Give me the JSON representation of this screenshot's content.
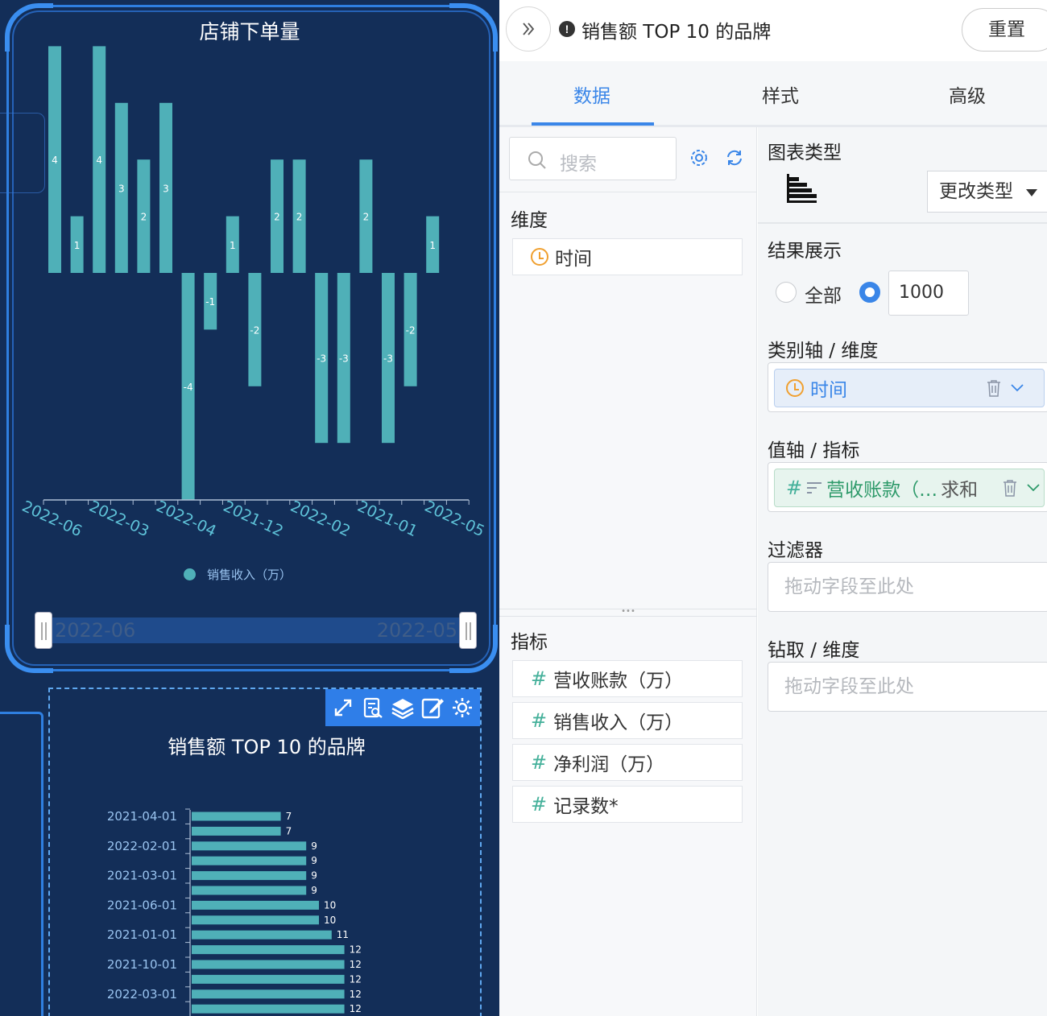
{
  "dashboard": {
    "card1": {
      "title": "店铺下单量",
      "legend": "销售收入（万）",
      "zoom_start": "2022-06",
      "zoom_end": "2022-05"
    },
    "card2": {
      "title": "销售额 TOP 10 的品牌",
      "toolbar_icons": [
        "expand-icon",
        "data-view-icon",
        "layers-icon",
        "edit-icon",
        "gear-icon"
      ]
    }
  },
  "chart_data": [
    {
      "type": "bar",
      "title": "店铺下单量",
      "categories": [
        "2022-06",
        "",
        "2022-03",
        "",
        "2022-04",
        "",
        "2021-12",
        "",
        "2022-02",
        "",
        "2021-01",
        "",
        "2022-05"
      ],
      "series": [
        {
          "name": "销售收入（万）",
          "values": [
            4,
            1,
            4,
            3,
            2,
            3,
            -4,
            -1,
            1,
            -2,
            2,
            2,
            -3,
            -3,
            2,
            -3,
            -2,
            1
          ]
        }
      ],
      "x_tick_labels": [
        "2022-06",
        "2022-03",
        "2022-04",
        "2021-12",
        "2022-02",
        "2021-01",
        "2022-05"
      ],
      "ylim": [
        -4,
        4
      ],
      "grid": false,
      "legend": "bottom",
      "bar_color": "#4fb0b8"
    },
    {
      "type": "bar",
      "orientation": "horizontal",
      "title": "销售额 TOP 10 的品牌",
      "y_tick_labels": [
        "2021-04-01",
        "2022-02-01",
        "2021-03-01",
        "2021-06-01",
        "2021-01-01",
        "2021-10-01",
        "2022-03-01"
      ],
      "values": [
        7,
        7,
        9,
        9,
        9,
        9,
        10,
        10,
        11,
        12,
        12,
        12,
        12,
        12
      ],
      "bar_color": "#4fb0b8",
      "grid": false
    }
  ],
  "panel": {
    "title": "销售额 TOP 10 的品牌",
    "reset": "重置",
    "tabs": [
      "数据",
      "样式",
      "高级"
    ],
    "search_placeholder": "搜索",
    "dimensions_title": "维度",
    "dimensions": [
      "时间"
    ],
    "measures_title": "指标",
    "measures": [
      "营收账款（万）",
      "销售收入（万）",
      "净利润（万）",
      "记录数*"
    ],
    "chart_type_title": "图表类型",
    "change_type": "更改类型",
    "result_title": "结果展示",
    "result_all": "全部",
    "result_limit": "1000",
    "category_axis_title": "类别轴 / 维度",
    "category_field": "时间",
    "value_axis_title": "值轴 / 指标",
    "value_field": "营收账款（…",
    "value_agg": "求和",
    "filter_title": "过滤器",
    "drag_placeholder": "拖动字段至此处",
    "drill_title": "钻取 / 维度",
    "accent_color": "#3a86e8"
  }
}
